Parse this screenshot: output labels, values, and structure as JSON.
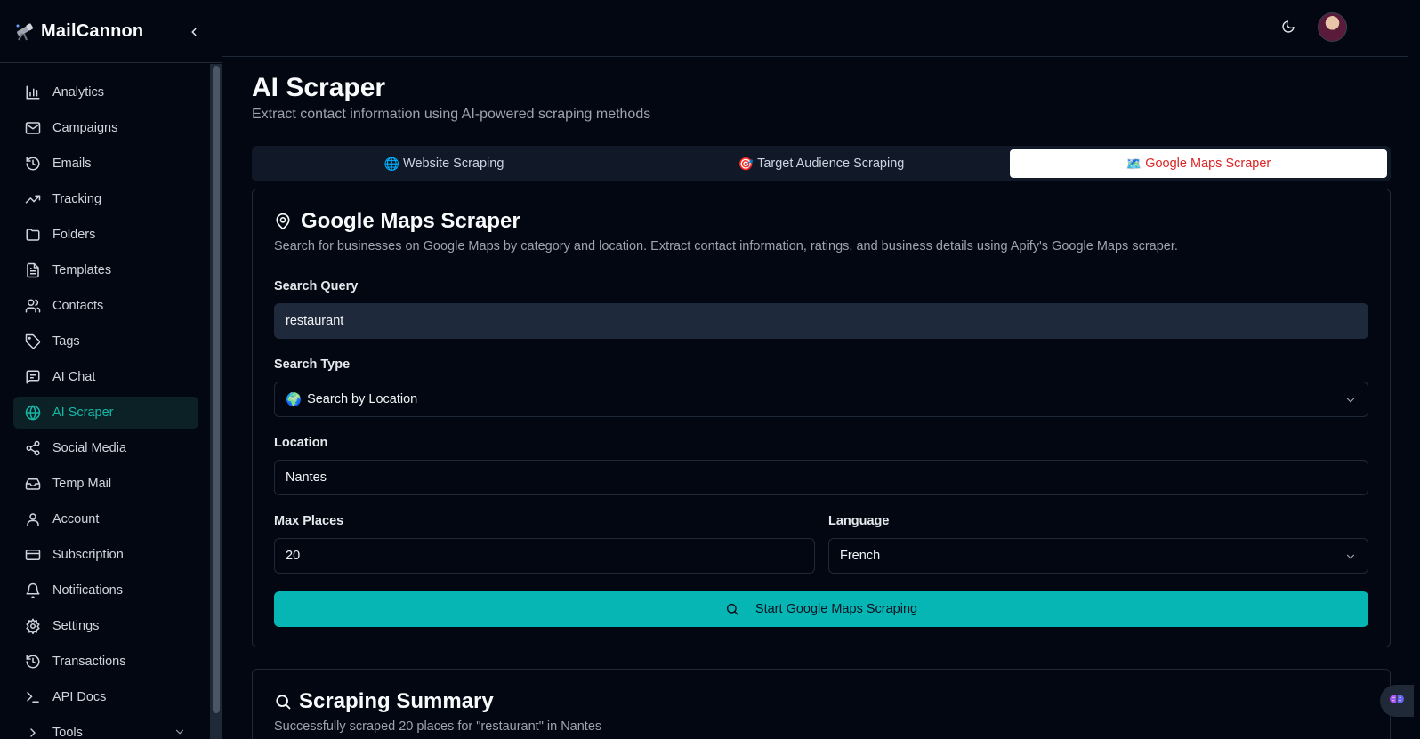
{
  "app": {
    "name": "MailCannon"
  },
  "sidebar": {
    "items": [
      {
        "label": "Analytics",
        "icon": "bar-chart-icon"
      },
      {
        "label": "Campaigns",
        "icon": "mail-icon"
      },
      {
        "label": "Emails",
        "icon": "history-icon"
      },
      {
        "label": "Tracking",
        "icon": "trending-up-icon"
      },
      {
        "label": "Folders",
        "icon": "folder-icon"
      },
      {
        "label": "Templates",
        "icon": "file-text-icon"
      },
      {
        "label": "Contacts",
        "icon": "users-icon"
      },
      {
        "label": "Tags",
        "icon": "tag-icon"
      },
      {
        "label": "AI Chat",
        "icon": "message-square-icon"
      },
      {
        "label": "AI Scraper",
        "icon": "globe-icon",
        "active": true
      },
      {
        "label": "Social Media",
        "icon": "share-icon"
      },
      {
        "label": "Temp Mail",
        "icon": "inbox-icon"
      },
      {
        "label": "Account",
        "icon": "user-icon"
      },
      {
        "label": "Subscription",
        "icon": "credit-card-icon"
      },
      {
        "label": "Notifications",
        "icon": "bell-icon"
      },
      {
        "label": "Settings",
        "icon": "gear-icon"
      },
      {
        "label": "Transactions",
        "icon": "history-icon"
      },
      {
        "label": "API Docs",
        "icon": "terminal-icon"
      },
      {
        "label": "Tools",
        "icon": "chevron-right-icon"
      }
    ]
  },
  "page": {
    "title": "AI Scraper",
    "subtitle": "Extract contact information using AI-powered scraping methods"
  },
  "tabs": [
    {
      "emoji": "🌐",
      "label": "Website Scraping"
    },
    {
      "emoji": "🎯",
      "label": "Target Audience Scraping"
    },
    {
      "emoji": "🗺️",
      "label": "Google Maps Scraper",
      "active": true
    }
  ],
  "form": {
    "title": "Google Maps Scraper",
    "description": "Search for businesses on Google Maps by category and location. Extract contact information, ratings, and business details using Apify's Google Maps scraper.",
    "search_query_label": "Search Query",
    "search_query_value": "restaurant",
    "search_type_label": "Search Type",
    "search_type_emoji": "🌍",
    "search_type_value": "Search by Location",
    "location_label": "Location",
    "location_value": "Nantes",
    "max_places_label": "Max Places",
    "max_places_value": "20",
    "language_label": "Language",
    "language_value": "French",
    "submit_label": "Start Google Maps Scraping"
  },
  "summary": {
    "title": "Scraping Summary",
    "description": "Successfully scraped 20 places for \"restaurant\" in Nantes"
  },
  "colors": {
    "accent": "#06b6b4",
    "active_tab_text": "#dc2626",
    "background": "#030712"
  }
}
